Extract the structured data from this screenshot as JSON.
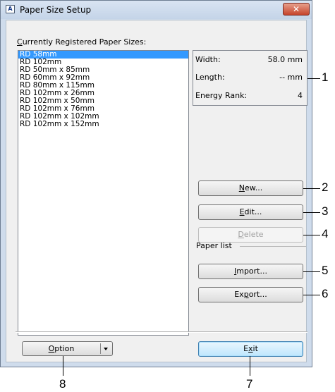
{
  "window": {
    "title": "Paper Size Setup",
    "icon_letter": "A",
    "close_label": "✕"
  },
  "list": {
    "label_prefix": "",
    "label_mnemonic": "C",
    "label_rest": "urrently Registered Paper Sizes:",
    "items": [
      "RD 58mm",
      "RD 102mm",
      "RD 50mm x 85mm",
      "RD 60mm x 92mm",
      "RD 80mm x 115mm",
      "RD 102mm x 26mm",
      "RD 102mm x 50mm",
      "RD 102mm x 76mm",
      "RD 102mm x 102mm",
      "RD 102mm x 152mm"
    ],
    "selected_index": 0
  },
  "info": {
    "width_label": "Width:",
    "width_value": "58.0 mm",
    "length_label": "Length:",
    "length_value": "-- mm",
    "energy_label": "Energy Rank:",
    "energy_value": "4"
  },
  "buttons": {
    "new": {
      "mnemonic": "N",
      "rest": "ew..."
    },
    "edit": {
      "mnemonic": "E",
      "rest": "dit..."
    },
    "delete": {
      "mnemonic": "D",
      "rest": "elete"
    },
    "import": {
      "mnemonic": "I",
      "rest": "mport..."
    },
    "export_pre": "Ex",
    "export_mnemonic": "p",
    "export_rest": "ort...",
    "option_mnemonic": "O",
    "option_rest": "ption",
    "exit_pre": "E",
    "exit_mnemonic": "x",
    "exit_rest": "it"
  },
  "paper_list_label": "Paper list",
  "callouts": [
    "1",
    "2",
    "3",
    "4",
    "5",
    "6",
    "7",
    "8"
  ],
  "colors": {
    "selection": "#3399ff",
    "close": "#c5442c",
    "frame": "#cfdcec"
  }
}
